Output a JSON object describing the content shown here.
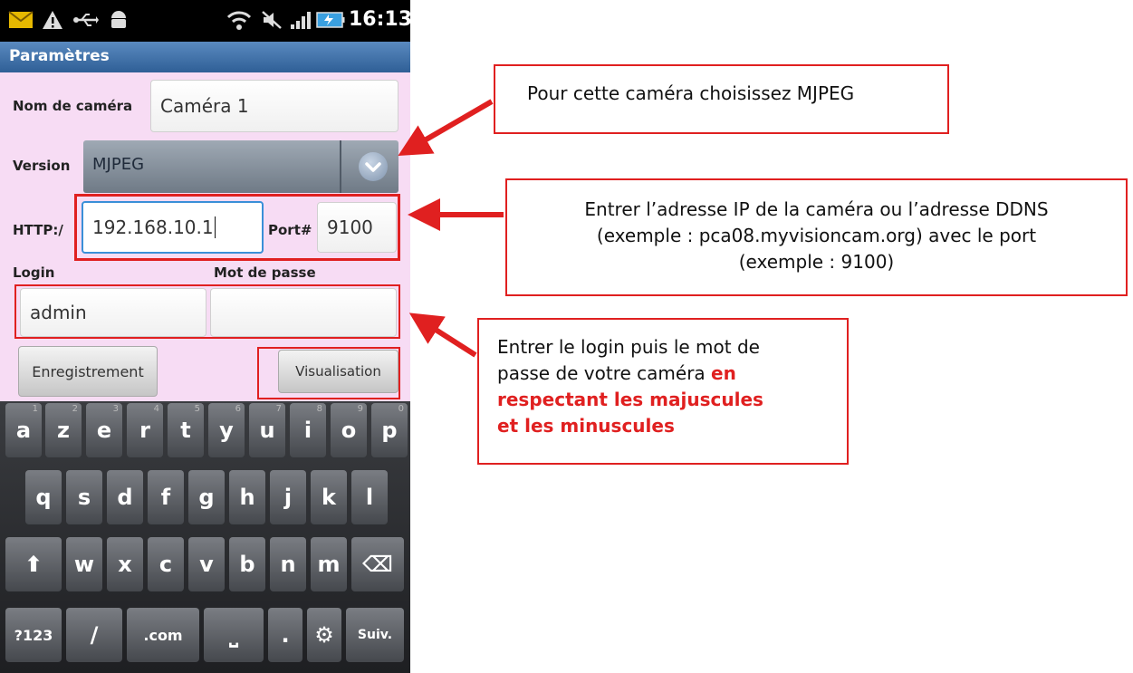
{
  "status_bar": {
    "time": "16:13",
    "icons": [
      "mail-icon",
      "warning-icon",
      "usb-icon",
      "android-icon",
      "wifi-icon",
      "mute-icon",
      "signal-icon",
      "battery-icon"
    ]
  },
  "app": {
    "title": "Paramètres",
    "camera_name_label": "Nom de caméra",
    "camera_name_value": "Caméra 1",
    "version_label": "Version",
    "version_value": "MJPEG",
    "http_label": "HTTP:/",
    "address_value": "192.168.10.1",
    "port_label": "Port#",
    "port_value": "9100",
    "login_label": "Login",
    "password_label": "Mot de passe",
    "login_value": "admin",
    "password_value": "",
    "save_button": "Enregistrement",
    "view_button": "Visualisation"
  },
  "keyboard": {
    "row1": [
      {
        "k": "a",
        "n": "1"
      },
      {
        "k": "z",
        "n": "2"
      },
      {
        "k": "e",
        "n": "3"
      },
      {
        "k": "r",
        "n": "4"
      },
      {
        "k": "t",
        "n": "5"
      },
      {
        "k": "y",
        "n": "6"
      },
      {
        "k": "u",
        "n": "7"
      },
      {
        "k": "i",
        "n": "8"
      },
      {
        "k": "o",
        "n": "9"
      },
      {
        "k": "p",
        "n": "0"
      }
    ],
    "row2": [
      "q",
      "s",
      "d",
      "f",
      "g",
      "h",
      "j",
      "k",
      "l"
    ],
    "row3": [
      "w",
      "x",
      "c",
      "v",
      "b",
      "n",
      "m"
    ],
    "shift": "⬆",
    "backspace": "⌫",
    "sym": "?123",
    "slash": "/",
    "dotcom": ".com",
    "space": "⎵",
    "dot": ".",
    "settings": "⚙",
    "next": "Suiv."
  },
  "callouts": {
    "version": "Pour cette caméra choisissez MJPEG",
    "address_line1": "Entrer l’adresse IP de la caméra ou l’adresse DDNS",
    "address_line2": "(exemple : pca08.myvisioncam.org) avec le port",
    "address_line3": "(exemple : 9100)",
    "login_line1": "Entrer le login puis le mot de",
    "login_line2_plain": "passe de votre caméra ",
    "login_line2_emph": "en",
    "login_line3_emph": "respectant les majuscules",
    "login_line4_emph": "et les minuscules"
  },
  "colors": {
    "highlight_red": "#e02020",
    "form_background": "#f7dcf4",
    "title_bar_blue": "#3a6aa3"
  }
}
